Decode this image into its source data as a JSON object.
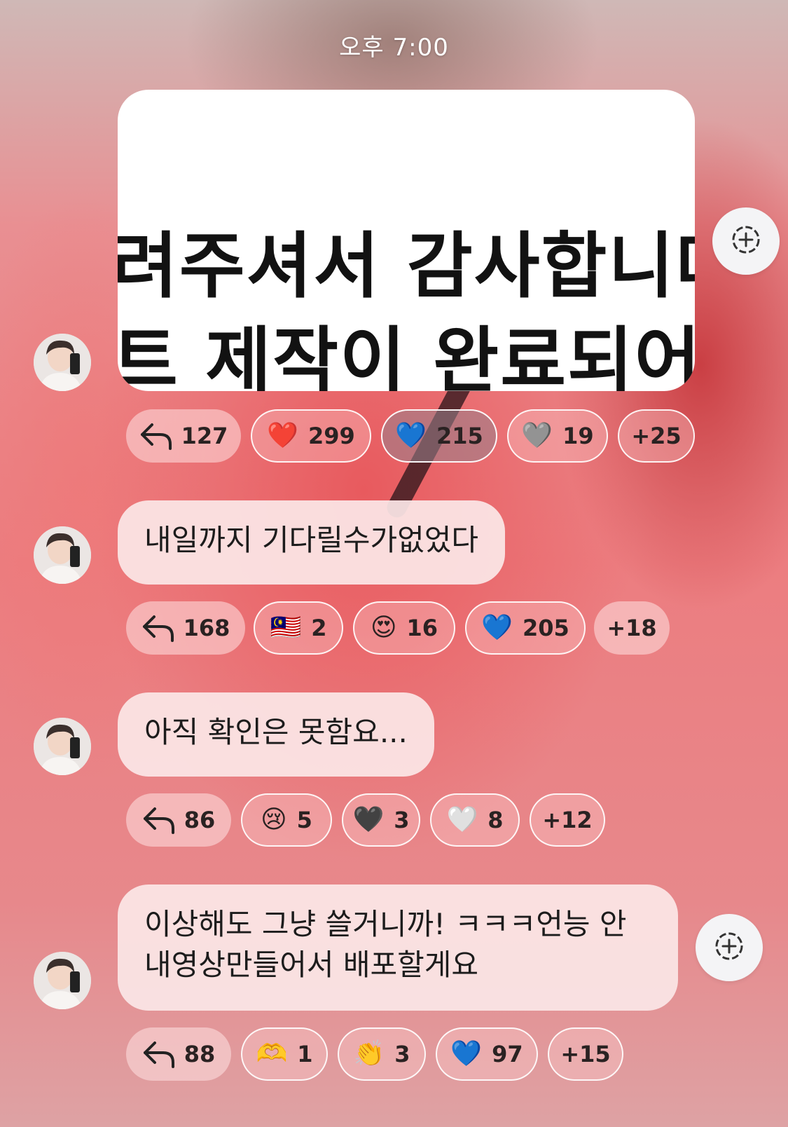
{
  "timestamp": "오후 7:00",
  "messages": [
    {
      "type": "image",
      "image_lines": [
        "려주셔서 감사합니다",
        "트 제작이 완료되어 와"
      ],
      "reactions": {
        "reply_count": "127",
        "items": [
          {
            "emoji": "❤️",
            "count": "299"
          },
          {
            "emoji": "💙",
            "count": "215"
          },
          {
            "emoji": "🩶",
            "count": "19"
          }
        ],
        "more": "+25"
      }
    },
    {
      "type": "text",
      "text": "내일까지 기다릴수가없었다",
      "reactions": {
        "reply_count": "168",
        "items": [
          {
            "emoji": "🇲🇾",
            "count": "2"
          },
          {
            "emoji": "😍",
            "count": "16"
          },
          {
            "emoji": "💙",
            "count": "205"
          }
        ],
        "more": "+18"
      }
    },
    {
      "type": "text",
      "text": "아직 확인은 못함요...",
      "reactions": {
        "reply_count": "86",
        "items": [
          {
            "emoji": "😢",
            "count": "5"
          },
          {
            "emoji": "🖤",
            "count": "3"
          },
          {
            "emoji": "🤍",
            "count": "8"
          }
        ],
        "more": "+12"
      }
    },
    {
      "type": "text",
      "lines": [
        "이상해도 그냥 쓸거니까! ㅋㅋㅋ언능 안",
        "내영상만들어서 배포할게요"
      ],
      "reactions": {
        "reply_count": "88",
        "items": [
          {
            "emoji": "🫶",
            "count": "1"
          },
          {
            "emoji": "👏",
            "count": "3"
          },
          {
            "emoji": "💙",
            "count": "97"
          }
        ],
        "more": "+15"
      }
    }
  ],
  "icons": {
    "reply": "reply-arrow-icon",
    "add_reaction": "add-reaction-icon",
    "avatar": "profile-avatar"
  },
  "colors": {
    "bubble": "#fbe6e6",
    "chip_active": "#968c8c",
    "background": "#e98f92"
  }
}
